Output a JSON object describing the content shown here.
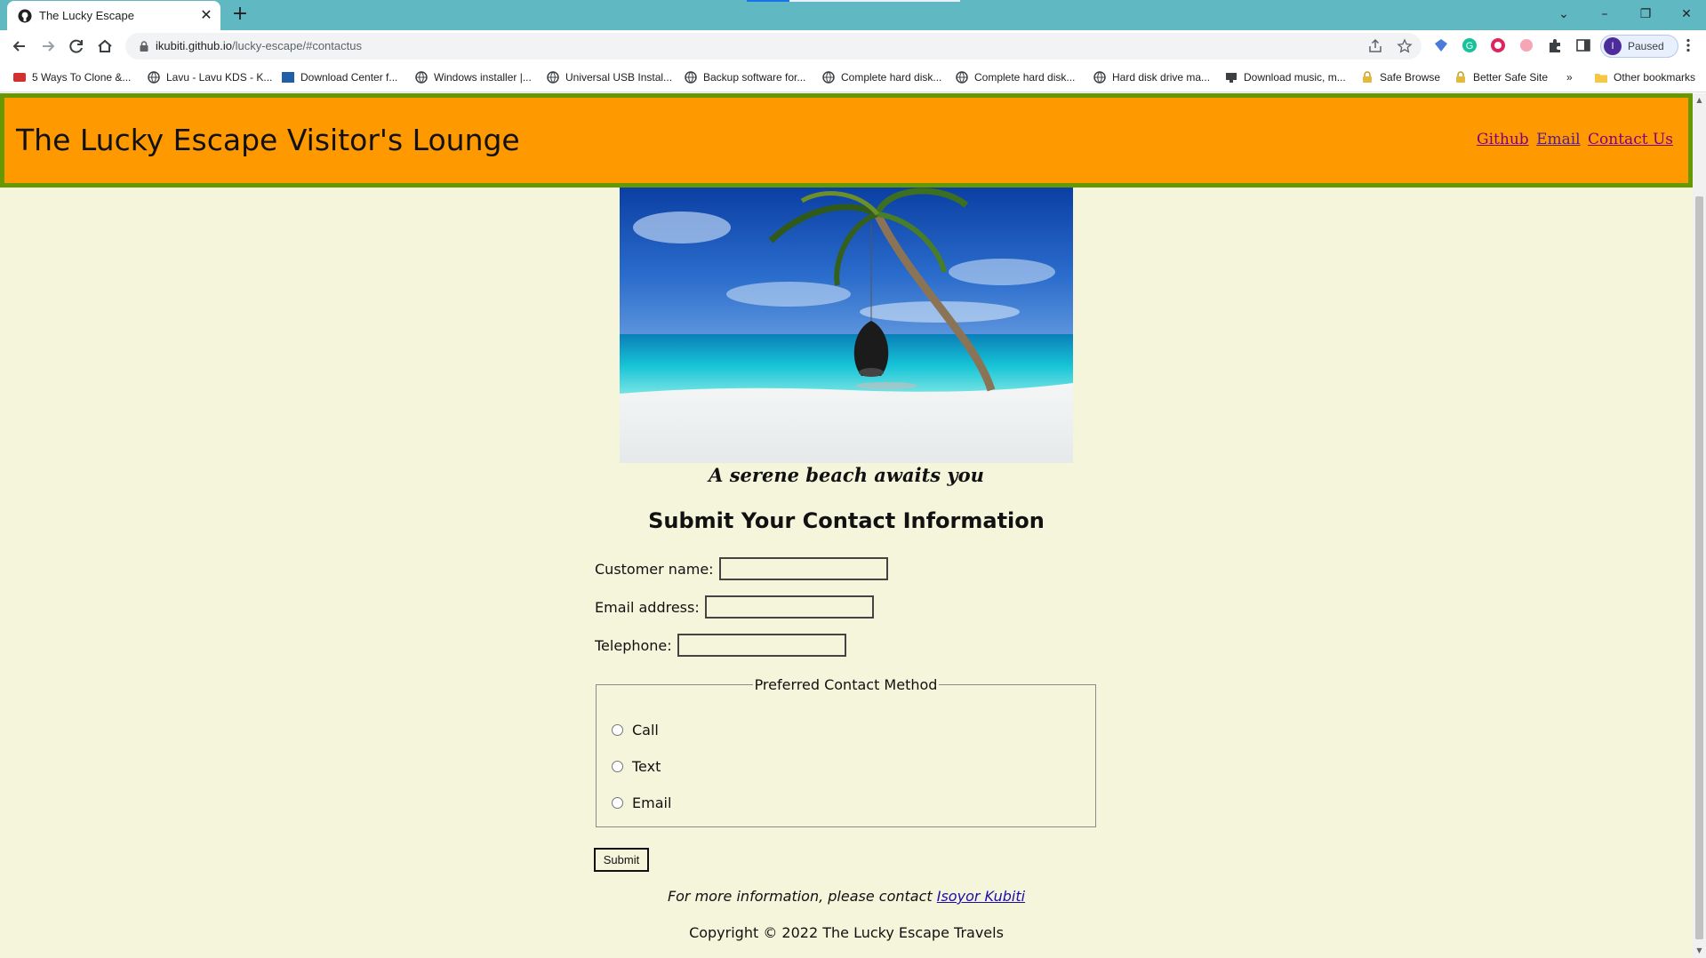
{
  "browser": {
    "tab_title": "The Lucky Escape",
    "tab_close": "✕",
    "new_tab": "+",
    "window_buttons": {
      "tabsearch": "⌄",
      "minimize": "–",
      "restore": "❐",
      "close": "✕"
    },
    "url_host": "ikubiti.github.io",
    "url_path": "/lucky-escape/#contactus",
    "profile_initial": "I",
    "profile_status": "Paused",
    "bookmarks": [
      {
        "label": "5 Ways To Clone &...",
        "icon": "red-logo-icon"
      },
      {
        "label": "Lavu - Lavu KDS - K...",
        "icon": "globe-icon"
      },
      {
        "label": "Download Center f...",
        "icon": "blue-logo-icon"
      },
      {
        "label": "Windows installer |...",
        "icon": "globe-icon"
      },
      {
        "label": "Universal USB Instal...",
        "icon": "globe-icon"
      },
      {
        "label": "Backup software for...",
        "icon": "globe-icon"
      },
      {
        "label": "Complete hard disk...",
        "icon": "globe-icon"
      },
      {
        "label": "Complete hard disk...",
        "icon": "globe-icon"
      },
      {
        "label": "Hard disk drive ma...",
        "icon": "globe-icon"
      },
      {
        "label": "Download music, m...",
        "icon": "monitor-icon"
      },
      {
        "label": "Safe Browse",
        "icon": "lock-icon"
      },
      {
        "label": "Better Safe Site",
        "icon": "lock-icon"
      }
    ],
    "bookmarks_overflow": "»",
    "other_bookmarks": "Other bookmarks",
    "colors": {
      "tabstrip": "#5fb8c2",
      "load_indicator": "#1a73e8"
    }
  },
  "site": {
    "title": "The Lucky Escape Visitor's Lounge",
    "nav": {
      "github": "Github",
      "email": "Email",
      "contact": "Contact Us"
    },
    "hero_caption": "A serene beach awaits you",
    "form_title": "Submit Your Contact Information",
    "fields": {
      "name_label": "Customer name:",
      "email_label": "Email address:",
      "phone_label": "Telephone:"
    },
    "contact_method": {
      "legend": "Preferred Contact Method",
      "options": [
        "Call",
        "Text",
        "Email"
      ]
    },
    "submit_label": "Submit",
    "more_info_text": "For more information, please contact ",
    "more_info_link": "Isoyor Kubiti",
    "copyright": "Copyright © 2022 The Lucky Escape Travels",
    "colors": {
      "header_bg": "#ff9900",
      "header_border": "#669900",
      "page_bg": "#f5f5dc"
    }
  }
}
